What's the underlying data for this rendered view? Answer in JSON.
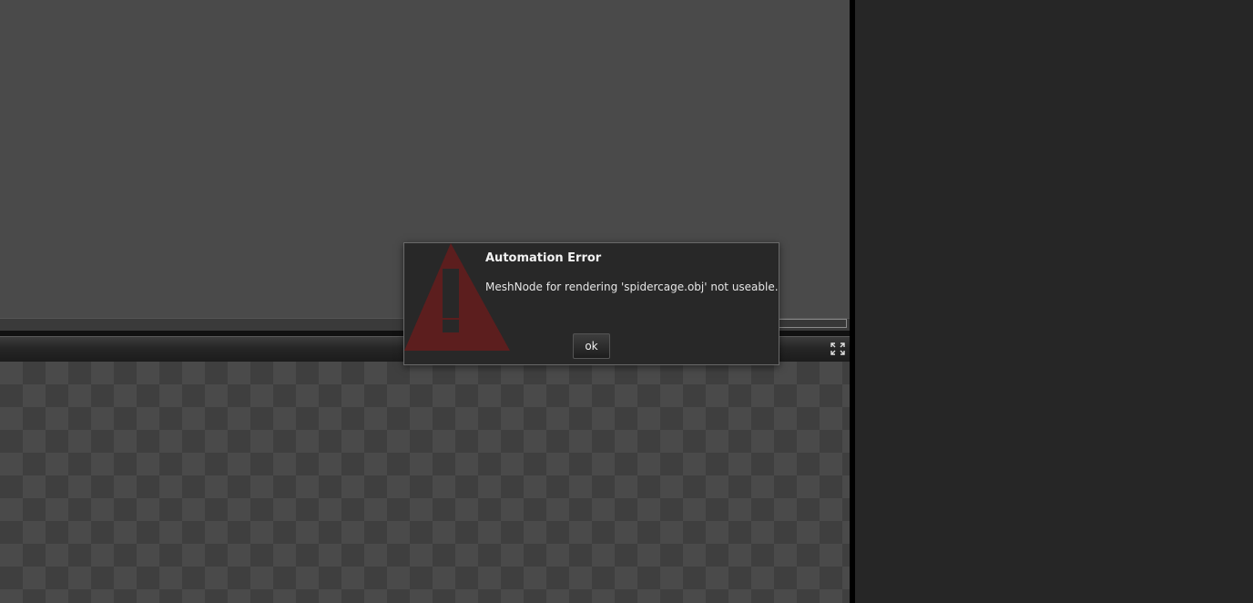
{
  "dialog": {
    "title": "Automation Error",
    "message": "MeshNode for rendering 'spidercage.obj' not useable.",
    "ok_label": "ok"
  },
  "icons": {
    "warning": "warning-triangle-icon",
    "expand": "expand-fullscreen-icon"
  },
  "colors": {
    "viewport_bg": "#4a4a4a",
    "panel_bg": "#262626",
    "warning_red": "#5c1e1e",
    "dialog_bg": "#282828"
  }
}
